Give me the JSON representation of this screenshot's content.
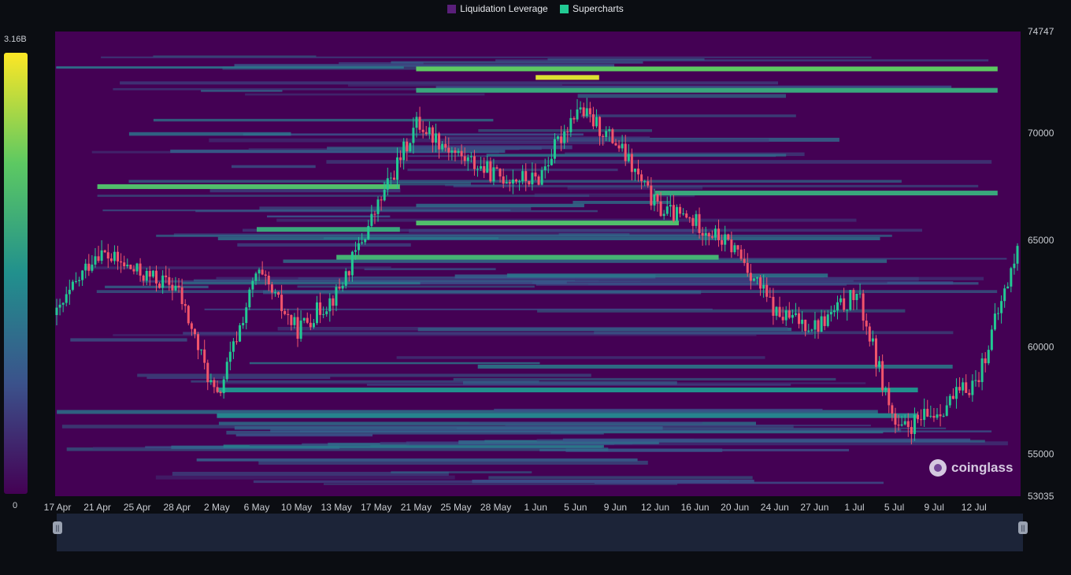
{
  "legend": {
    "items": [
      {
        "label": "Liquidation Leverage",
        "color": "#440154"
      },
      {
        "label": "Supercharts",
        "color": "#22c993"
      }
    ]
  },
  "colorbar": {
    "max_label": "3.16B",
    "min_label": "0",
    "palette": [
      "#440154",
      "#3b528b",
      "#21908d",
      "#5dc962",
      "#fde725"
    ]
  },
  "watermark": {
    "text": "coinglass",
    "icon": "coinglass-logo-icon"
  },
  "colors": {
    "up": "#22c993",
    "down": "#f2546b",
    "background": "#440154"
  },
  "chart_data": {
    "type": "heatmap",
    "title": "",
    "x_tick_labels": [
      "17 Apr",
      "21 Apr",
      "25 Apr",
      "28 Apr",
      "2 May",
      "6 May",
      "10 May",
      "13 May",
      "17 May",
      "21 May",
      "25 May",
      "28 May",
      "1 Jun",
      "5 Jun",
      "9 Jun",
      "12 Jun",
      "16 Jun",
      "20 Jun",
      "24 Jun",
      "27 Jun",
      "1 Jul",
      "5 Jul",
      "9 Jul",
      "12 Jul"
    ],
    "y_tick_labels": [
      "74747",
      "70000",
      "65000",
      "60000",
      "55000",
      "53035"
    ],
    "ylim": [
      53035,
      74747
    ],
    "color_scale_range": [
      "0",
      "3.16B"
    ],
    "price_series": {
      "name": "Supercharts",
      "dates": [
        "17 Apr",
        "21 Apr",
        "25 Apr",
        "28 Apr",
        "2 May",
        "6 May",
        "10 May",
        "13 May",
        "17 May",
        "21 May",
        "25 May",
        "28 May",
        "1 Jun",
        "5 Jun",
        "9 Jun",
        "12 Jun",
        "16 Jun",
        "20 Jun",
        "24 Jun",
        "27 Jun",
        "1 Jul",
        "5 Jul",
        "9 Jul",
        "12 Jul",
        "15 Jul"
      ],
      "close": [
        61500,
        64500,
        63500,
        62800,
        57500,
        63500,
        60800,
        62500,
        66500,
        70500,
        69000,
        68000,
        67800,
        71200,
        69500,
        66500,
        65800,
        64500,
        61500,
        61000,
        62500,
        56000,
        57000,
        58500,
        64500
      ]
    },
    "liquidation_bands": [
      {
        "price": 73000,
        "intensity": 0.75,
        "from": "21 May",
        "to": "12 Jul"
      },
      {
        "price": 72600,
        "intensity": 0.95,
        "from": "1 Jun",
        "to": "5 Jun"
      },
      {
        "price": 72000,
        "intensity": 0.6,
        "from": "21 May",
        "to": "12 Jul"
      },
      {
        "price": 67500,
        "intensity": 0.7,
        "from": "21 Apr",
        "to": "17 May"
      },
      {
        "price": 67200,
        "intensity": 0.6,
        "from": "12 Jun",
        "to": "12 Jul"
      },
      {
        "price": 65800,
        "intensity": 0.7,
        "from": "21 May",
        "to": "12 Jun"
      },
      {
        "price": 65500,
        "intensity": 0.6,
        "from": "6 May",
        "to": "17 May"
      },
      {
        "price": 64200,
        "intensity": 0.65,
        "from": "13 May",
        "to": "16 Jun"
      },
      {
        "price": 58000,
        "intensity": 0.5,
        "from": "2 May",
        "to": "5 Jul"
      },
      {
        "price": 56800,
        "intensity": 0.45,
        "from": "2 May",
        "to": "5 Jul"
      }
    ],
    "grid": false,
    "legend_position": "top-center"
  }
}
